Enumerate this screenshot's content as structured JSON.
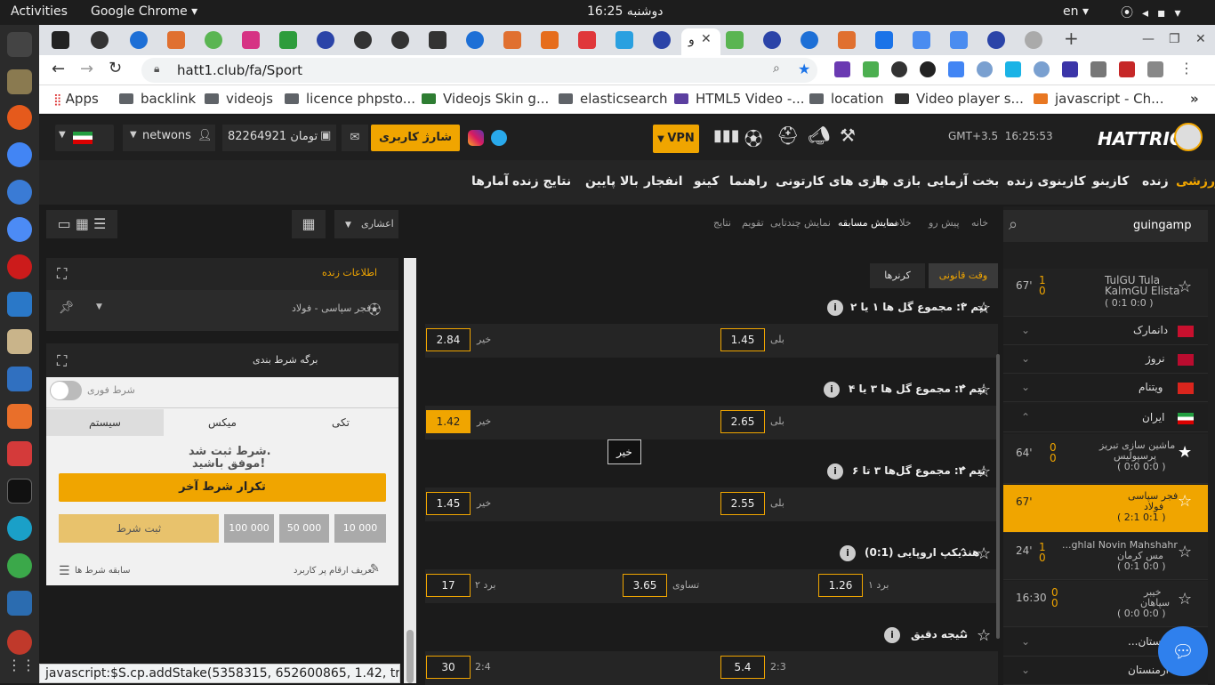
{
  "system": {
    "activities": "Activities",
    "app_name": "Google Chrome",
    "clock": "دوشنبه 16:25",
    "lang": "en"
  },
  "browser": {
    "url": "hatt1.club/fa/Sport",
    "active_tab_title": "و",
    "bookmarks": [
      "Apps",
      "backlink",
      "videojs",
      "licence phpsto...",
      "Videojs Skin g...",
      "elasticsearch",
      "HTML5 Video -...",
      "location",
      "Video player s...",
      "javascript - Ch..."
    ],
    "status_bar": "javascript:$S.cp.addStake(5358315, 652600865, 1.42, true);"
  },
  "site": {
    "logo": "HATTRICK",
    "server_time": "GMT+3.5  16:25:53",
    "vpn_label": "VPN",
    "charge_button": "شارژ کاربری",
    "balance": "82264921 تومان",
    "username": "netwons",
    "nav": [
      "ورزشی",
      "زنده",
      "کازینو",
      "کازینوی زنده",
      "بخت آزمایی",
      "بازی ها",
      "بازی های کارتونی",
      "راهنما",
      "کینو",
      "انفجار",
      "بالا پایین",
      "نتایج زنده",
      "آمارها"
    ],
    "breadcrumbs": [
      "خانه",
      "پیش رو",
      "خلاصه",
      "نمایش مسابقه",
      "نمایش چندتایی",
      "تقویم",
      "نتایج"
    ],
    "odds_format": "اعشاری"
  },
  "sidebar": {
    "search_value": "guingamp",
    "matches_top": [
      {
        "home": "TulGU Tula",
        "away": "KalmGU Elista",
        "score": "( 0:1  0:0 )",
        "minute": "67'",
        "goals": [
          "1",
          "0"
        ]
      }
    ],
    "countries": [
      {
        "name": "دانمارک",
        "flag": "dk"
      },
      {
        "name": "نروژ",
        "flag": "no"
      },
      {
        "name": "ویتنام",
        "flag": "vn"
      },
      {
        "name": "ایران",
        "flag": "ir"
      }
    ],
    "iran_matches": [
      {
        "home": "ماشین سازی تبریز",
        "away": "پرسپولیس",
        "score": "( 0:0  0:0 )",
        "minute": "64'",
        "goals": [
          "0",
          "0"
        ]
      },
      {
        "home": "فجر سپاسی",
        "away": "فولاد",
        "score": "( 2:1  0:1 )",
        "minute": "67'",
        "goals": [
          "",
          ""
        ]
      },
      {
        "home": "...ghlal Novin Mahshahr",
        "away": "مس کرمان",
        "score": "( 0:1  0:0 )",
        "minute": "24'",
        "goals": [
          "1",
          "0"
        ]
      },
      {
        "home": "خیبر",
        "away": "سپاهان",
        "score": "( 0:0  0:0 )",
        "minute": "16:30",
        "goals": [
          "0",
          "0"
        ]
      }
    ],
    "countries_bottom": [
      "...ستان",
      "ارمنستان"
    ]
  },
  "center": {
    "tab_regular": "وقت قانونی",
    "tab_corners": "کرنرها",
    "tooltip": "خیر",
    "markets": [
      {
        "title": "تیم ۲: مجموع گل ها ۱ یا ۲",
        "opt1_label": "بلی",
        "opt1": "1.45",
        "opt2_label": "خیر",
        "opt2": "2.84"
      },
      {
        "title": "تیم ۲: مجموع گل ها ۳ یا ۴",
        "opt1_label": "بلی",
        "opt1": "2.65",
        "opt2_label": "خیر",
        "opt2": "1.42"
      },
      {
        "title": "تیم ۲: مجموع گل‌ها ۳ تا ۶",
        "opt1_label": "بلی",
        "opt1": "2.55",
        "opt2_label": "خیر",
        "opt2": "1.45"
      }
    ],
    "handicap": {
      "title": "هندیکپ اروپایی (0:1)",
      "l1": "برد ۱",
      "v1": "1.26",
      "l2": "تساوی",
      "v2": "3.65",
      "l3": "برد ۲",
      "v3": "17"
    },
    "exact": {
      "title": "نتیجه دقیق",
      "l1": "2:3",
      "v1": "5.4",
      "l2": "2:4",
      "v2": "30"
    }
  },
  "betslip": {
    "live_info": "اطلاعات زنده",
    "match": "فجر سپاسی - فولاد",
    "slip_title": "برگه شرط بندی",
    "instant_bet": "شرط فوری",
    "tabs": [
      "تکی",
      "میکس",
      "سیستم"
    ],
    "success_line1": "شرط ثبت شد.",
    "success_line2": "موفق باشید!",
    "repeat_bet": "تکرار شرط آخر",
    "place_bet": "ثبت شرط",
    "stakes": [
      "100 000",
      "50 000",
      "10 000"
    ],
    "history": "سابقه شرط ها",
    "define_amounts": "تعریف ارقام پر کاربرد"
  }
}
